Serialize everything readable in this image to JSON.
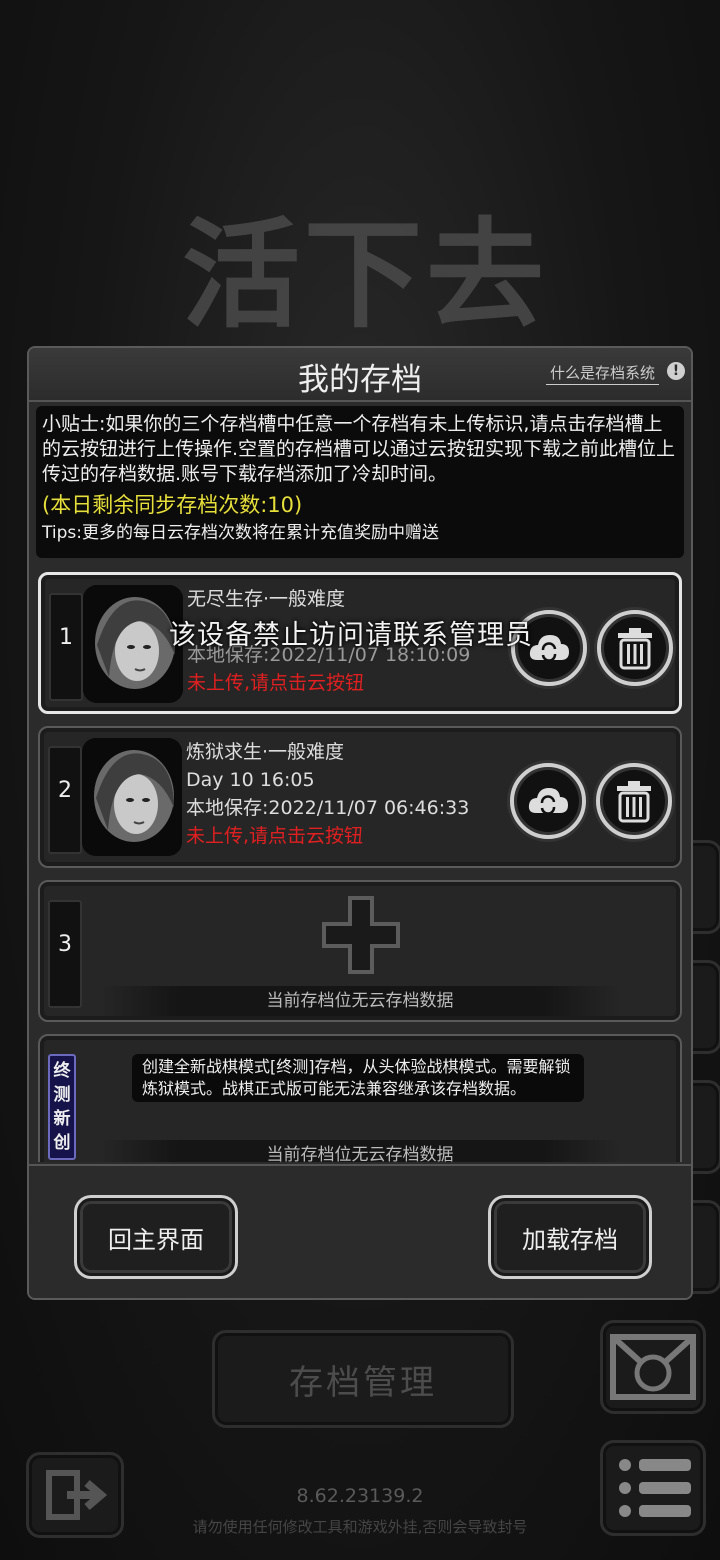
{
  "background": {
    "game_title": "活下去",
    "save_manage_label": "存档管理",
    "version": "8.62.23139.2",
    "warning": "请勿使用任何修改工具和游戏外挂,否则会导致封号"
  },
  "dialog": {
    "title": "我的存档",
    "help_link": "什么是存档系统",
    "help_icon": "!",
    "tips": {
      "main": "小贴士:如果你的三个存档槽中任意一个存档有未上传标识,请点击存档槽上的云按钮进行上传操作.空置的存档槽可以通过云按钮实现下载之前此槽位上传过的存档数据.账号下载存档添加了冷却时间。",
      "sync_count": "(本日剩余同步存档次数:10)",
      "more": "Tips:更多的每日云存档次数将在累计充值奖励中赠送"
    },
    "overlay_message": "该设备禁止访问请联系管理员",
    "slots": [
      {
        "number": "1",
        "mode": "无尽生存·一般难度",
        "day_time": "",
        "local_save": "本地保存:2022/11/07  18:10:09",
        "status": "未上传,请点击云按钮"
      },
      {
        "number": "2",
        "mode": "炼狱求生·一般难度",
        "day_time": "Day 10  16:05",
        "local_save": "本地保存:2022/11/07  06:46:33",
        "status": "未上传,请点击云按钮"
      },
      {
        "number": "3",
        "empty_label": "当前存档位无云存档数据"
      }
    ],
    "new_mode": {
      "badge": "终测新创",
      "description": "创建全新战棋模式[终测]存档，从头体验战棋模式。需要解锁炼狱模式。战棋正式版可能无法兼容继承该存档数据。",
      "empty_label": "当前存档位无云存档数据"
    },
    "buttons": {
      "back": "回主界面",
      "load": "加载存档"
    }
  },
  "icons": [
    "cloud-sync-icon",
    "trash-icon",
    "plus-icon",
    "exit-icon",
    "mail-icon",
    "menu-icon",
    "help-icon"
  ]
}
